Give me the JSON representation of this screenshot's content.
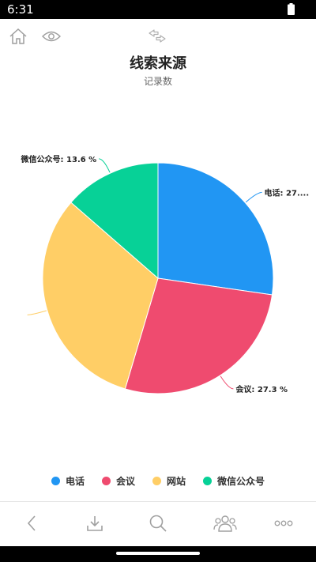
{
  "status_bar": {
    "time": "6:31",
    "battery_icon": "battery-full-icon"
  },
  "toolbar": {
    "home_icon": "home-icon",
    "eye_icon": "eye-icon",
    "swap_icon": "swap-arrows-icon"
  },
  "bottom_bar": {
    "items": [
      "chevron-left-icon",
      "download-icon",
      "search-icon",
      "people-icon",
      "more-icon"
    ]
  },
  "chart_data": {
    "type": "pie",
    "title": "线索来源",
    "subtitle": "记录数",
    "categories": [
      "电话",
      "会议",
      "网站",
      "微信公众号"
    ],
    "values": [
      27.3,
      27.3,
      31.8,
      13.6
    ],
    "unit": "%",
    "colors": [
      "#2196F3",
      "#EF4B6F",
      "#FFCE66",
      "#07D197"
    ],
    "data_labels": [
      "电话: 27....",
      "会议: 27.3 %",
      "",
      "微信公众号: 13.6 %"
    ],
    "legend": [
      "电话",
      "会议",
      "网站",
      "微信公众号"
    ],
    "legend_position": "bottom-center",
    "start_angle_deg": 0,
    "direction": "clockwise"
  }
}
